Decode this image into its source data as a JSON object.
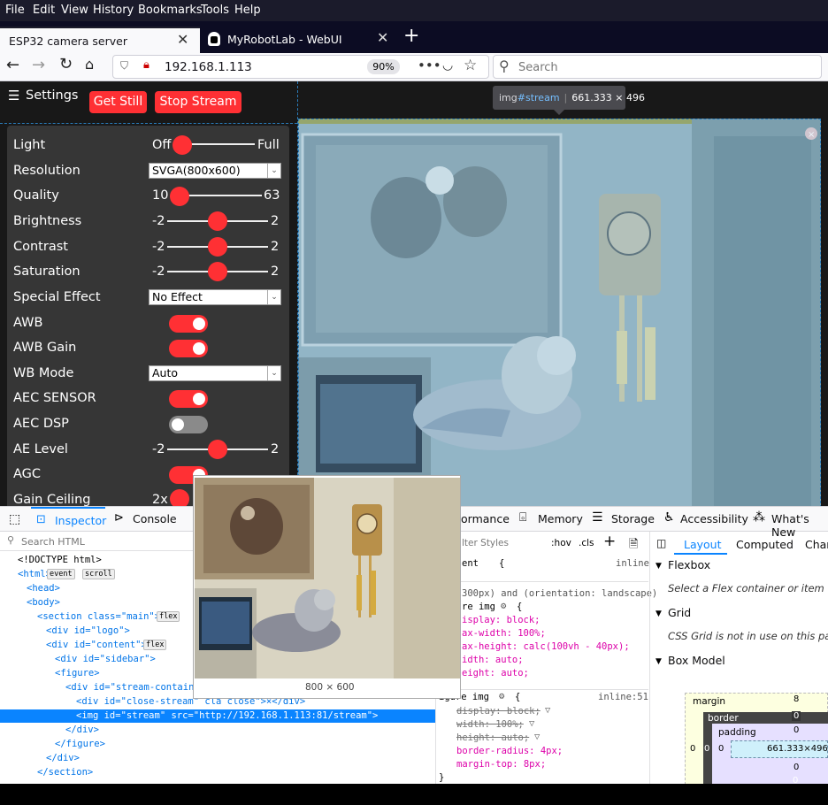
{
  "menubar": {
    "items": [
      "File",
      "Edit",
      "View",
      "History",
      "Bookmarks",
      "Tools",
      "Help"
    ]
  },
  "tabs": [
    {
      "title": "ESP32 camera server",
      "active": true
    },
    {
      "title": "MyRobotLab - WebUI",
      "active": false
    }
  ],
  "navbar": {
    "url": "192.168.1.113",
    "zoom": "90%",
    "search_placeholder": "Search"
  },
  "page": {
    "settings_label": "Settings",
    "get_still": "Get Still",
    "stop_stream": "Stop Stream",
    "tooltip": {
      "tag": "img",
      "id": "#stream",
      "size": "661.333 × 496"
    }
  },
  "controls": {
    "light": {
      "label": "Light",
      "min": "Off",
      "max": "Full",
      "value": 0
    },
    "resolution": {
      "label": "Resolution",
      "selected": "SVGA(800x600)"
    },
    "quality": {
      "label": "Quality",
      "min": "10",
      "max": "63",
      "value": 10
    },
    "brightness": {
      "label": "Brightness",
      "min": "-2",
      "max": "2",
      "value": 0
    },
    "contrast": {
      "label": "Contrast",
      "min": "-2",
      "max": "2",
      "value": 0
    },
    "saturation": {
      "label": "Saturation",
      "min": "-2",
      "max": "2",
      "value": 0
    },
    "special_effect": {
      "label": "Special Effect",
      "selected": "No Effect"
    },
    "awb": {
      "label": "AWB",
      "on": true
    },
    "awb_gain": {
      "label": "AWB Gain",
      "on": true
    },
    "wb_mode": {
      "label": "WB Mode",
      "selected": "Auto"
    },
    "aec_sensor": {
      "label": "AEC SENSOR",
      "on": true
    },
    "aec_dsp": {
      "label": "AEC DSP",
      "on": false
    },
    "ae_level": {
      "label": "AE Level",
      "min": "-2",
      "max": "2",
      "value": 0
    },
    "agc": {
      "label": "AGC",
      "on": true
    },
    "gain_ceiling": {
      "label": "Gain Ceiling",
      "min": "2x"
    }
  },
  "devtools": {
    "tabs": [
      "Inspector",
      "Console",
      "ormance",
      "Memory",
      "Storage",
      "Accessibility",
      "What's New"
    ],
    "search_html": "Search HTML",
    "filter_styles": "lter Styles",
    "hov": ":hov",
    "cls": ".cls",
    "layout_tabs": [
      "Layout",
      "Computed",
      "Char"
    ],
    "html_lines": [
      "<!DOCTYPE html>",
      "<html>",
      "<head>",
      "<body>",
      "<section class=\"main\">",
      "<div id=\"logo\">",
      "<div id=\"content\">",
      "<div id=\"sidebar\">",
      "<figure>",
      "<div id=\"stream-containe",
      "<div id=\"close-stream\" cla  close\">×</div>",
      "<img id=\"stream\" src=\"http://192.168.1.113:81/stream\">",
      "</div>",
      "</figure>",
      "</div>",
      "</section>"
    ],
    "badges": {
      "event": "event",
      "scroll": "scroll",
      "flex": "flex",
      "dots": "⋯"
    },
    "preview_size": "800 × 600",
    "rules": {
      "element": "ent",
      "inline": "inline",
      "media": "300px) and (orientation: landscape)",
      "sel1": "re img",
      "decls1": [
        "isplay: block;",
        "ax-width: 100%;",
        "ax-height: calc(100vh - 40px);",
        "idth: auto;",
        "eight: auto;"
      ],
      "sel2": "igure img",
      "src2": "inline:51",
      "decls2": [
        "display: block;",
        "width: 100%;",
        "height: auto;",
        "border-radius: 4px;",
        "margin-top: 8px;"
      ]
    },
    "layout": {
      "flexbox": "Flexbox",
      "flexbox_msg": "Select a Flex container or item to co",
      "grid": "Grid",
      "grid_msg": "CSS Grid is not in use on this page",
      "boxmodel": "Box Model",
      "margin": "margin",
      "border": "border",
      "padding": "padding",
      "content_size": "661.333×496",
      "margin_top": "8",
      "border_top": "0",
      "padding_top": "0",
      "left_m": "0",
      "left_b": "0",
      "left_p": "0",
      "bottom_p": "0",
      "bottom_b": "0"
    }
  }
}
